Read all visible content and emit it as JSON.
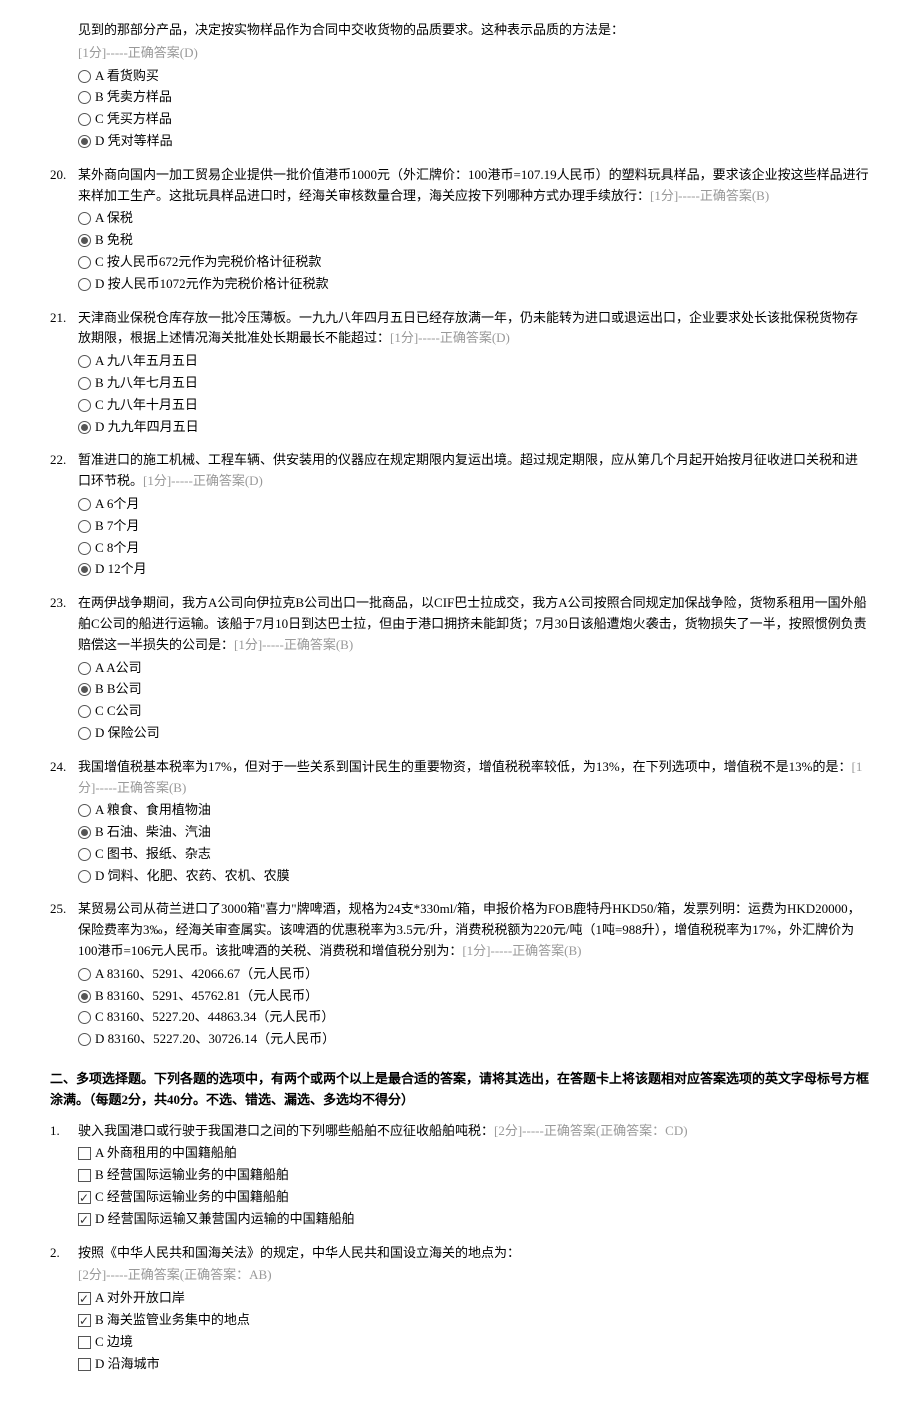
{
  "singleQuestions": [
    {
      "num": "",
      "text": "见到的那部分产品，决定按实物样品作为合同中交收货物的品质要求。这种表示品质的方法是：",
      "score": "[1分]-----正确答案(D)",
      "options": [
        {
          "label": "A 看货购买",
          "selected": false
        },
        {
          "label": "B 凭卖方样品",
          "selected": false
        },
        {
          "label": "C 凭买方样品",
          "selected": false
        },
        {
          "label": "D 凭对等样品",
          "selected": true
        }
      ]
    },
    {
      "num": "20.",
      "text": "某外商向国内一加工贸易企业提供一批价值港币1000元（外汇牌价：100港币=107.19人民币）的塑料玩具样品，要求该企业按这些样品进行来样加工生产。这批玩具样品进口时，经海关审核数量合理，海关应按下列哪种方式办理手续放行：",
      "score": "[1分]-----正确答案(B)",
      "inline": true,
      "options": [
        {
          "label": "A 保税",
          "selected": false
        },
        {
          "label": "B 免税",
          "selected": true
        },
        {
          "label": "C 按人民币672元作为完税价格计征税款",
          "selected": false
        },
        {
          "label": "D 按人民币1072元作为完税价格计征税款",
          "selected": false
        }
      ]
    },
    {
      "num": "21.",
      "text": "天津商业保税仓库存放一批冷压薄板。一九九八年四月五日已经存放满一年，仍未能转为进口或退运出口，企业要求处长该批保税货物存放期限，根据上述情况海关批准处长期最长不能超过：",
      "score": "[1分]-----正确答案(D)",
      "inline": true,
      "options": [
        {
          "label": "A 九八年五月五日",
          "selected": false
        },
        {
          "label": "B 九八年七月五日",
          "selected": false
        },
        {
          "label": "C 九八年十月五日",
          "selected": false
        },
        {
          "label": "D 九九年四月五日",
          "selected": true
        }
      ]
    },
    {
      "num": "22.",
      "text": "暂准进口的施工机械、工程车辆、供安装用的仪器应在规定期限内复运出境。超过规定期限，应从第几个月起开始按月征收进口关税和进口环节税。",
      "score": "[1分]-----正确答案(D)",
      "inline": true,
      "options": [
        {
          "label": "A 6个月",
          "selected": false
        },
        {
          "label": "B 7个月",
          "selected": false
        },
        {
          "label": "C 8个月",
          "selected": false
        },
        {
          "label": "D 12个月",
          "selected": true
        }
      ]
    },
    {
      "num": "23.",
      "text": "在两伊战争期间，我方A公司向伊拉克B公司出口一批商品，以CIF巴士拉成交，我方A公司按照合同规定加保战争险，货物系租用一国外船舶C公司的船进行运输。该船于7月10日到达巴士拉，但由于港口拥挤未能卸货；7月30日该船遭炮火袭击，货物损失了一半，按照惯例负责赔偿这一半损失的公司是：",
      "score": "[1分]-----正确答案(B)",
      "inline": true,
      "options": [
        {
          "label": "A A公司",
          "selected": false
        },
        {
          "label": "B B公司",
          "selected": true
        },
        {
          "label": "C C公司",
          "selected": false
        },
        {
          "label": "D 保险公司",
          "selected": false
        }
      ]
    },
    {
      "num": "24.",
      "text": "我国增值税基本税率为17%，但对于一些关系到国计民生的重要物资，增值税税率较低，为13%，在下列选项中，增值税不是13%的是：",
      "score": "[1分]-----正确答案(B)",
      "inline": true,
      "options": [
        {
          "label": "A 粮食、食用植物油",
          "selected": false
        },
        {
          "label": "B 石油、柴油、汽油",
          "selected": true
        },
        {
          "label": "C 图书、报纸、杂志",
          "selected": false
        },
        {
          "label": "D 饲料、化肥、农药、农机、农膜",
          "selected": false
        }
      ]
    },
    {
      "num": "25.",
      "text": "某贸易公司从荷兰进口了3000箱\"喜力\"牌啤酒，规格为24支*330ml/箱，申报价格为FOB鹿特丹HKD50/箱，发票列明：运费为HKD20000，保险费率为3‰，经海关审查属实。该啤酒的优惠税率为3.5元/升，消费税税额为220元/吨（1吨=988升），增值税税率为17%，外汇牌价为100港币=106元人民币。该批啤酒的关税、消费税和增值税分别为：",
      "score": "[1分]-----正确答案(B)",
      "inline": true,
      "options": [
        {
          "label": "A 83160、5291、42066.67（元人民币）",
          "selected": false
        },
        {
          "label": "B 83160、5291、45762.81（元人民币）",
          "selected": true
        },
        {
          "label": "C 83160、5227.20、44863.34（元人民币）",
          "selected": false
        },
        {
          "label": "D 83160、5227.20、30726.14（元人民币）",
          "selected": false
        }
      ]
    }
  ],
  "sectionHeader": "二、多项选择题。下列各题的选项中，有两个或两个以上是最合适的答案，请将其选出，在答题卡上将该题相对应答案选项的英文字母标号方框涂满。（每题2分，共40分。不选、错选、漏选、多选均不得分）",
  "multiQuestions": [
    {
      "num": "1.",
      "text": "驶入我国港口或行驶于我国港口之间的下列哪些船舶不应征收船舶吨税：",
      "score": "[2分]-----正确答案(正确答案：CD)",
      "inline": true,
      "options": [
        {
          "label": "A 外商租用的中国籍船舶",
          "selected": false
        },
        {
          "label": "B 经营国际运输业务的中国籍船舶",
          "selected": false
        },
        {
          "label": "C 经营国际运输业务的中国籍船舶",
          "selected": true
        },
        {
          "label": "D 经营国际运输又兼营国内运输的中国籍船舶",
          "selected": true
        }
      ]
    },
    {
      "num": "2.",
      "text": "按照《中华人民共和国海关法》的规定，中华人民共和国设立海关的地点为：",
      "score": "[2分]-----正确答案(正确答案：AB)",
      "inline": false,
      "options": [
        {
          "label": "A 对外开放口岸",
          "selected": true
        },
        {
          "label": "B 海关监管业务集中的地点",
          "selected": true
        },
        {
          "label": "C 边境",
          "selected": false
        },
        {
          "label": "D 沿海城市",
          "selected": false
        }
      ]
    }
  ]
}
